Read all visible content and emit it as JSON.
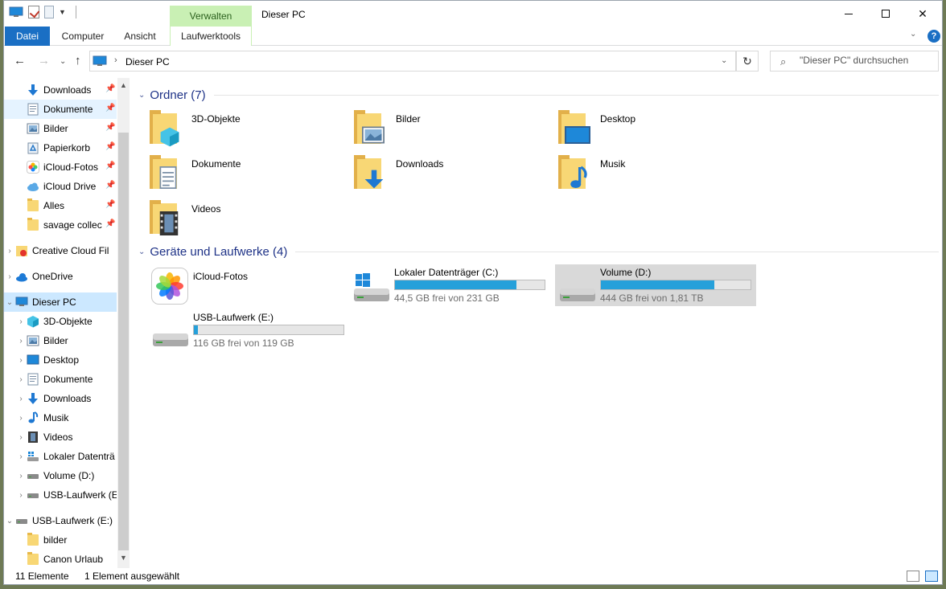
{
  "window": {
    "title": "Dieser PC",
    "context_tab": "Verwalten",
    "tabs": [
      "Datei",
      "Computer",
      "Ansicht",
      "Laufwerktools"
    ]
  },
  "address": {
    "path": "Dieser PC",
    "search_placeholder": "\"Dieser PC\" durchsuchen"
  },
  "sidebar": {
    "quick_access": [
      {
        "label": "Downloads",
        "icon": "download-icon"
      },
      {
        "label": "Dokumente",
        "icon": "documents-icon"
      },
      {
        "label": "Bilder",
        "icon": "pictures-icon"
      },
      {
        "label": "Papierkorb",
        "icon": "recycle-bin-icon"
      },
      {
        "label": "iCloud-Fotos",
        "icon": "icloud-photos-icon"
      },
      {
        "label": "iCloud Drive",
        "icon": "icloud-drive-icon"
      },
      {
        "label": "Alles",
        "icon": "folder-icon"
      },
      {
        "label": "savage collec",
        "icon": "folder-icon"
      }
    ],
    "creative_cloud": "Creative Cloud Fil",
    "onedrive": "OneDrive",
    "this_pc": "Dieser PC",
    "this_pc_children": [
      {
        "label": "3D-Objekte",
        "icon": "3d-objects-icon"
      },
      {
        "label": "Bilder",
        "icon": "pictures-icon"
      },
      {
        "label": "Desktop",
        "icon": "desktop-icon"
      },
      {
        "label": "Dokumente",
        "icon": "documents-icon"
      },
      {
        "label": "Downloads",
        "icon": "download-icon"
      },
      {
        "label": "Musik",
        "icon": "music-icon"
      },
      {
        "label": "Videos",
        "icon": "videos-icon"
      },
      {
        "label": "Lokaler Datenträ",
        "icon": "drive-icon"
      },
      {
        "label": "Volume (D:)",
        "icon": "drive-icon"
      },
      {
        "label": "USB-Laufwerk (E",
        "icon": "drive-icon"
      }
    ],
    "usb": "USB-Laufwerk (E:)",
    "usb_children": [
      {
        "label": "bilder",
        "icon": "folder-icon"
      },
      {
        "label": "Canon Urlaub",
        "icon": "folder-icon"
      }
    ]
  },
  "content": {
    "folders_header": "Ordner (7)",
    "folders": [
      {
        "label": "3D-Objekte",
        "icon": "3d-objects-folder-icon"
      },
      {
        "label": "Bilder",
        "icon": "pictures-folder-icon"
      },
      {
        "label": "Desktop",
        "icon": "desktop-folder-icon"
      },
      {
        "label": "Dokumente",
        "icon": "documents-folder-icon"
      },
      {
        "label": "Downloads",
        "icon": "downloads-folder-icon"
      },
      {
        "label": "Musik",
        "icon": "music-folder-icon"
      },
      {
        "label": "Videos",
        "icon": "videos-folder-icon"
      }
    ],
    "drives_header": "Geräte und Laufwerke (4)",
    "drives": [
      {
        "label": "iCloud-Fotos",
        "icon": "icloud-photos-icon"
      },
      {
        "label": "Lokaler Datenträger (C:)",
        "free": "44,5 GB frei von 231 GB",
        "used_fraction": 0.81,
        "icon": "windows-drive-icon"
      },
      {
        "label": "Volume (D:)",
        "free": "444 GB frei von 1,81 TB",
        "used_fraction": 0.76,
        "icon": "drive-icon",
        "selected": true
      },
      {
        "label": "USB-Laufwerk (E:)",
        "free": "116 GB frei von 119 GB",
        "used_fraction": 0.025,
        "icon": "usb-drive-icon"
      }
    ]
  },
  "status": {
    "count": "11 Elemente",
    "selection": "1 Element ausgewählt"
  },
  "colors": {
    "accent": "#1a6fc4",
    "selection": "#cce8ff",
    "drive_bar": "#26a0da",
    "context_tab": "#c9f0b4",
    "group_header": "#1e3287"
  }
}
